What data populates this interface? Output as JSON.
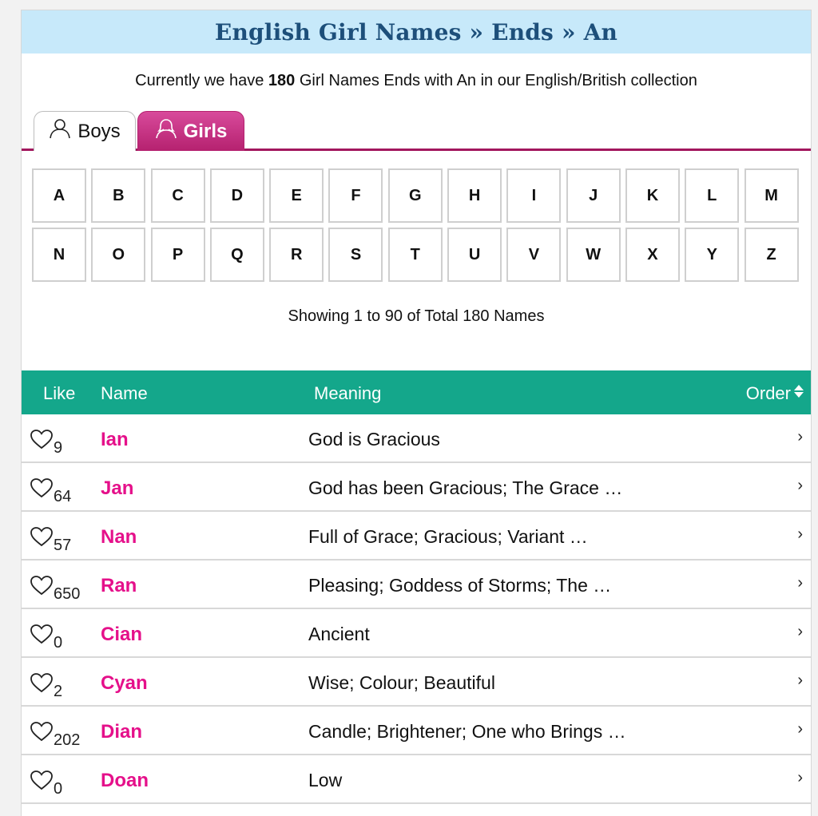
{
  "page": {
    "title": "English Girl Names » Ends » An",
    "summary_prefix": "Currently we have",
    "summary_count": "180",
    "summary_suffix": "Girl Names Ends with An in our English/British collection",
    "showing": "Showing 1 to 90 of Total 180 Names"
  },
  "tabs": [
    {
      "label": "Boys",
      "icon": "person-outline-icon",
      "active": false
    },
    {
      "label": "Girls",
      "icon": "person-female-icon",
      "active": true
    }
  ],
  "letters": [
    "A",
    "B",
    "C",
    "D",
    "E",
    "F",
    "G",
    "H",
    "I",
    "J",
    "K",
    "L",
    "M",
    "N",
    "O",
    "P",
    "Q",
    "R",
    "S",
    "T",
    "U",
    "V",
    "W",
    "X",
    "Y",
    "Z"
  ],
  "table": {
    "headers": {
      "like": "Like",
      "name": "Name",
      "meaning": "Meaning",
      "order": "Order"
    },
    "rows": [
      {
        "likes": "9",
        "name": "Ian",
        "meaning": "God is Gracious"
      },
      {
        "likes": "64",
        "name": "Jan",
        "meaning": "God has been Gracious; The Grace …"
      },
      {
        "likes": "57",
        "name": "Nan",
        "meaning": "Full of Grace; Gracious; Variant …"
      },
      {
        "likes": "650",
        "name": "Ran",
        "meaning": "Pleasing; Goddess of Storms; The …"
      },
      {
        "likes": "0",
        "name": "Cian",
        "meaning": "Ancient"
      },
      {
        "likes": "2",
        "name": "Cyan",
        "meaning": "Wise; Colour; Beautiful"
      },
      {
        "likes": "202",
        "name": "Dian",
        "meaning": "Candle; Brightener; One who Brings …"
      },
      {
        "likes": "0",
        "name": "Doan",
        "meaning": "Low"
      }
    ]
  },
  "colors": {
    "title_bg": "#c7e9fa",
    "title_text": "#1d4f7a",
    "girls_tab": "#c2307f",
    "table_header": "#14a78b",
    "name_text": "#e5108a"
  }
}
